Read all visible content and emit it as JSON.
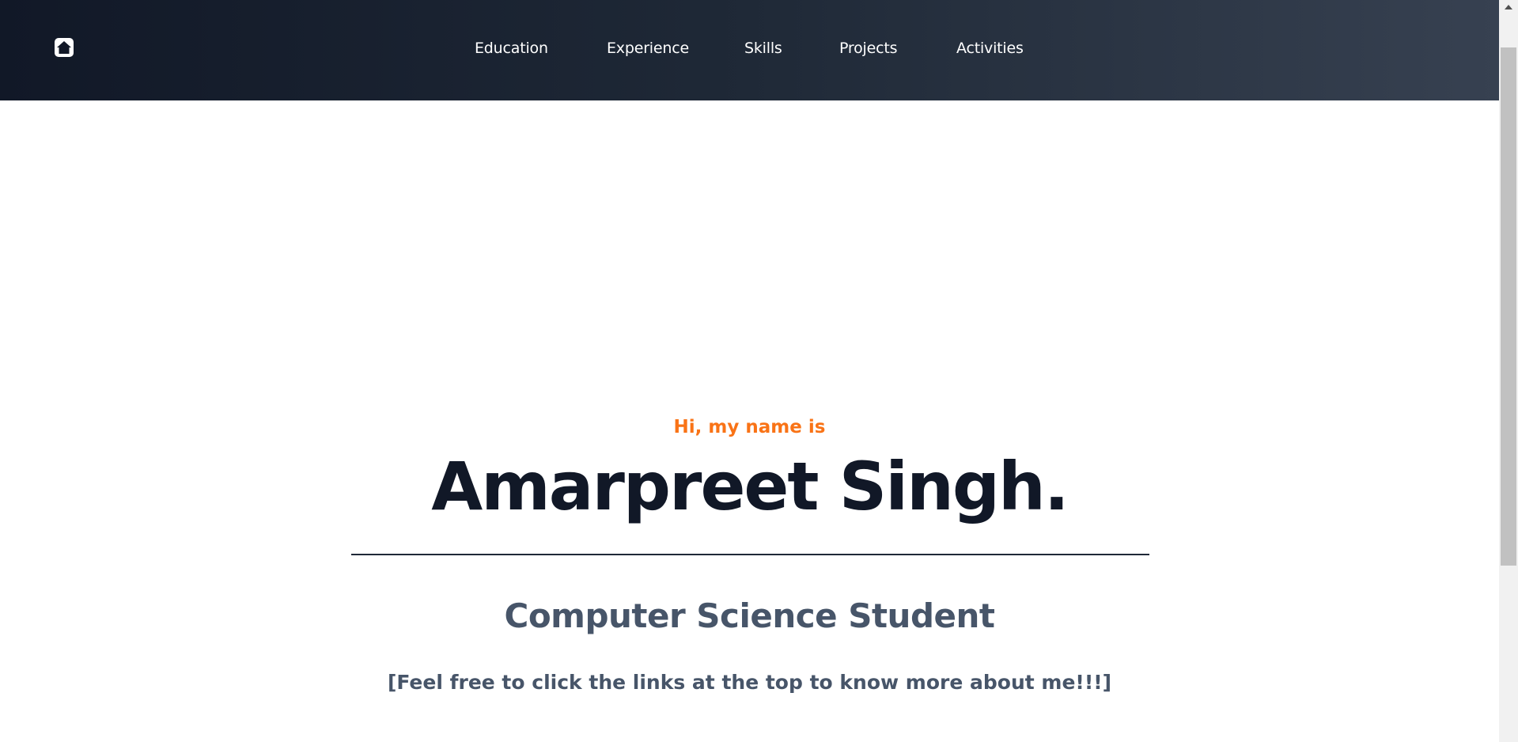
{
  "navbar": {
    "home_icon": "home-icon",
    "links": [
      {
        "label": "Education"
      },
      {
        "label": "Experience"
      },
      {
        "label": "Skills"
      },
      {
        "label": "Projects"
      },
      {
        "label": "Activities"
      }
    ]
  },
  "hero": {
    "greeting": "Hi, my name is",
    "name": "Amarpreet Singh.",
    "role": "Computer Science Student",
    "tagline": "[Feel free to click the links at the top to know more about me!!!]"
  },
  "colors": {
    "nav_gradient_start": "#111827",
    "nav_gradient_end": "#374151",
    "accent": "#f97316",
    "name": "#111827",
    "subtext": "#475569"
  }
}
